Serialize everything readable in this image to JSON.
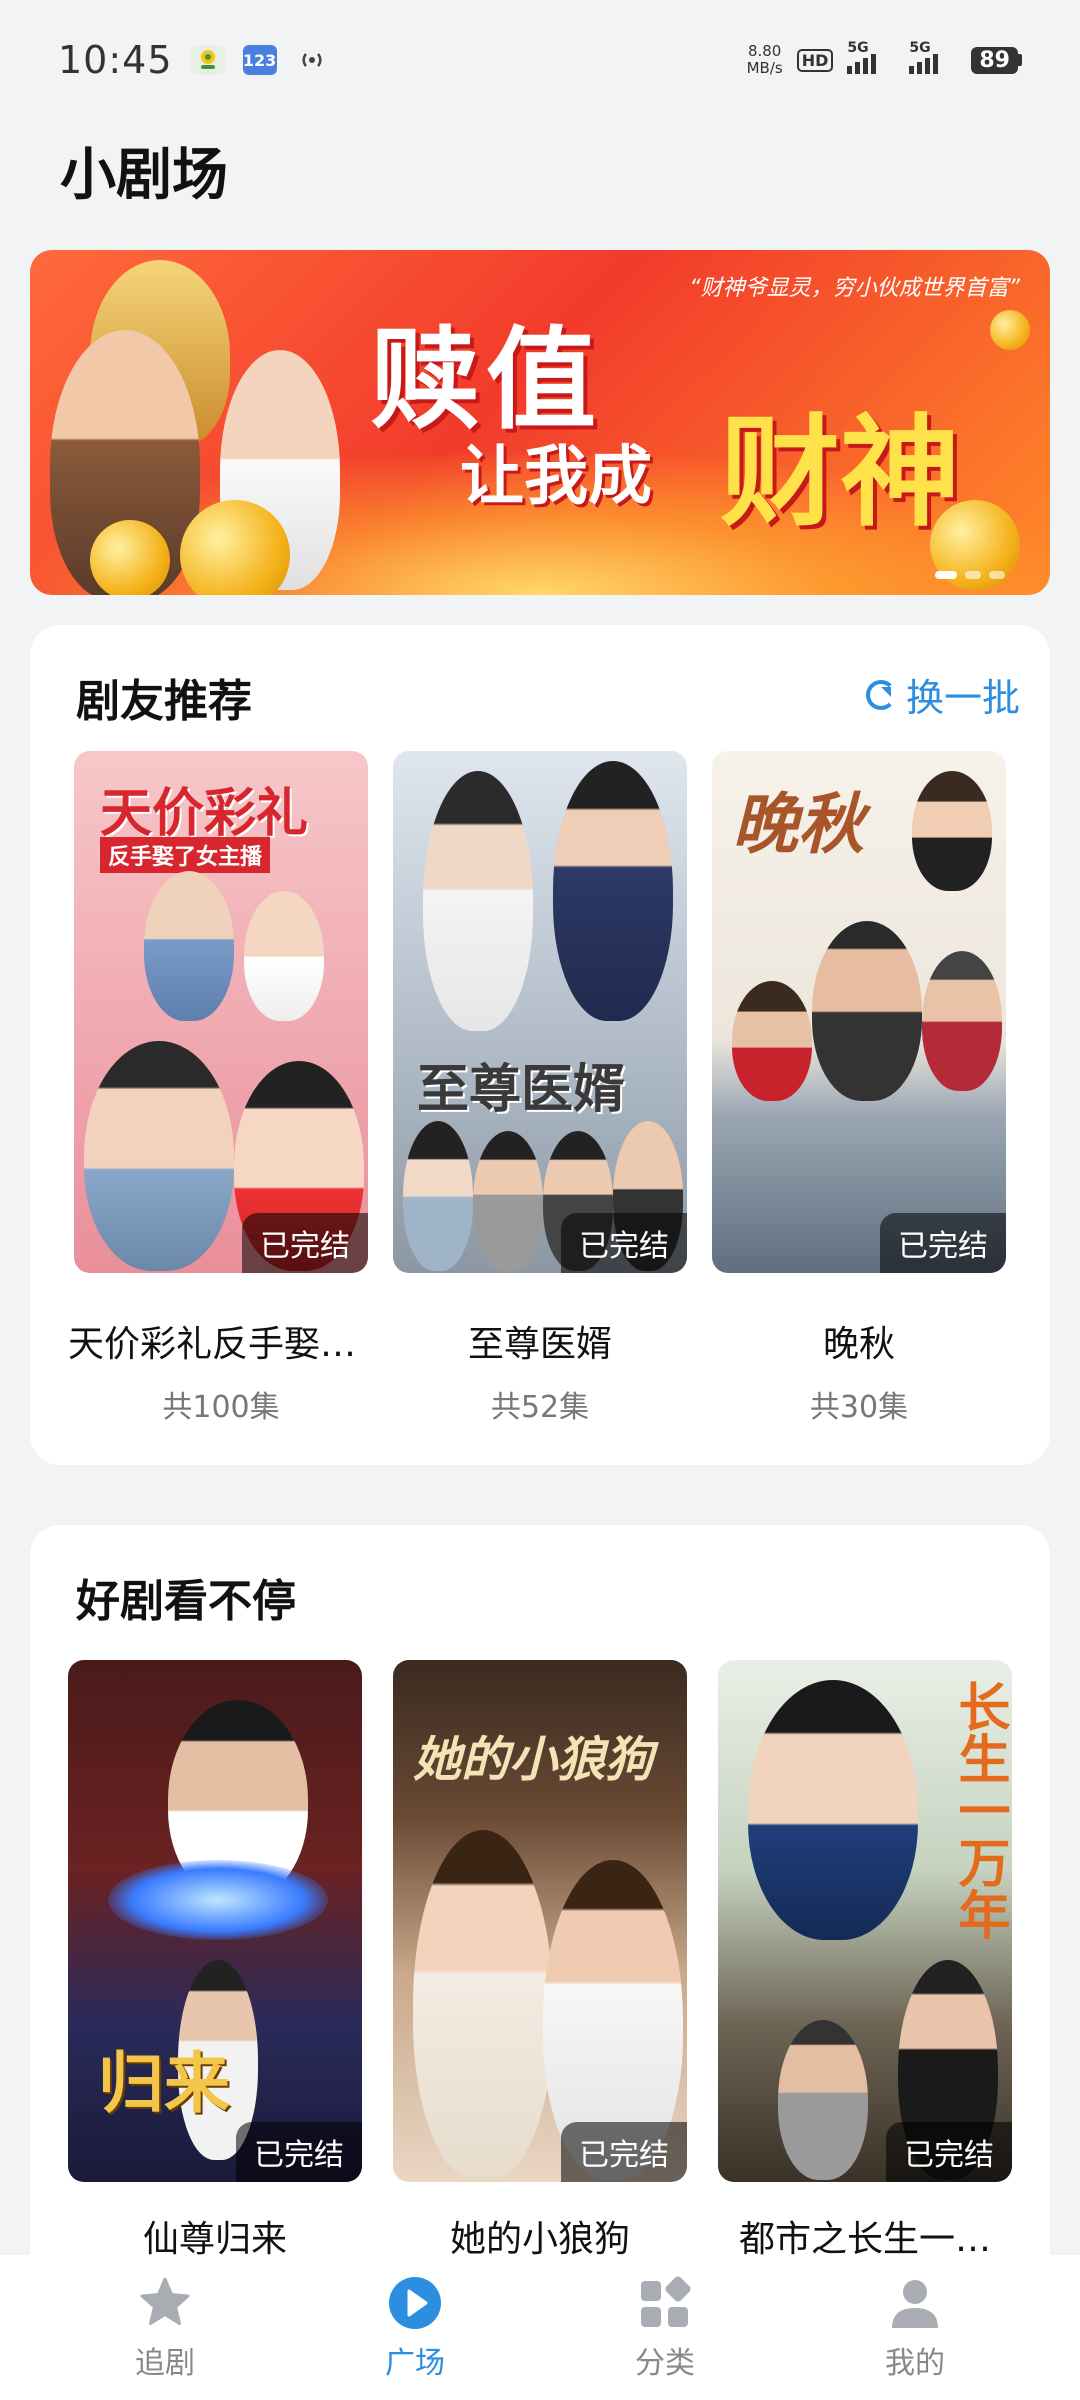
{
  "status_bar": {
    "time": "10:45",
    "speed_value": "8.80",
    "speed_unit": "MB/s",
    "hd": "HD",
    "hd_sub": "1 2",
    "net1": "5G",
    "net2": "5G",
    "battery": "89"
  },
  "page": {
    "title": "小剧场"
  },
  "banner": {
    "slogan": "“财神爷显灵，穷小伙成世界首富”",
    "headline": "赎值",
    "subline": "让我成",
    "highlight": "财神",
    "slides": 3
  },
  "section_recommend": {
    "title": "剧友推荐",
    "refresh_label": "换一批",
    "items": [
      {
        "poster_title": "天价彩礼",
        "poster_sub": "反手娶了女主播",
        "badge": "已完结",
        "name": "天价彩礼反手娶…",
        "count": "共100集"
      },
      {
        "poster_title": "至尊医婿",
        "badge": "已完结",
        "name": "至尊医婿",
        "count": "共52集"
      },
      {
        "poster_title": "晚秋",
        "badge": "已完结",
        "name": "晚秋",
        "count": "共30集"
      }
    ]
  },
  "section_binge": {
    "title": "好剧看不停",
    "items": [
      {
        "poster_title": "归来",
        "badge": "已完结",
        "name": "仙尊归来"
      },
      {
        "poster_title": "她的小狼狗",
        "badge": "已完结",
        "name": "她的小狼狗"
      },
      {
        "poster_title": "长生一万年",
        "badge": "已完结",
        "name": "都市之长生一…"
      }
    ]
  },
  "bottom_nav": [
    {
      "label": "追剧",
      "icon": "star-icon",
      "active": false
    },
    {
      "label": "广场",
      "icon": "play-icon",
      "active": true
    },
    {
      "label": "分类",
      "icon": "category-icon",
      "active": false
    },
    {
      "label": "我的",
      "icon": "user-icon",
      "active": false
    }
  ],
  "colors": {
    "accent": "#2b8ee0",
    "background": "#f2f3f5"
  }
}
